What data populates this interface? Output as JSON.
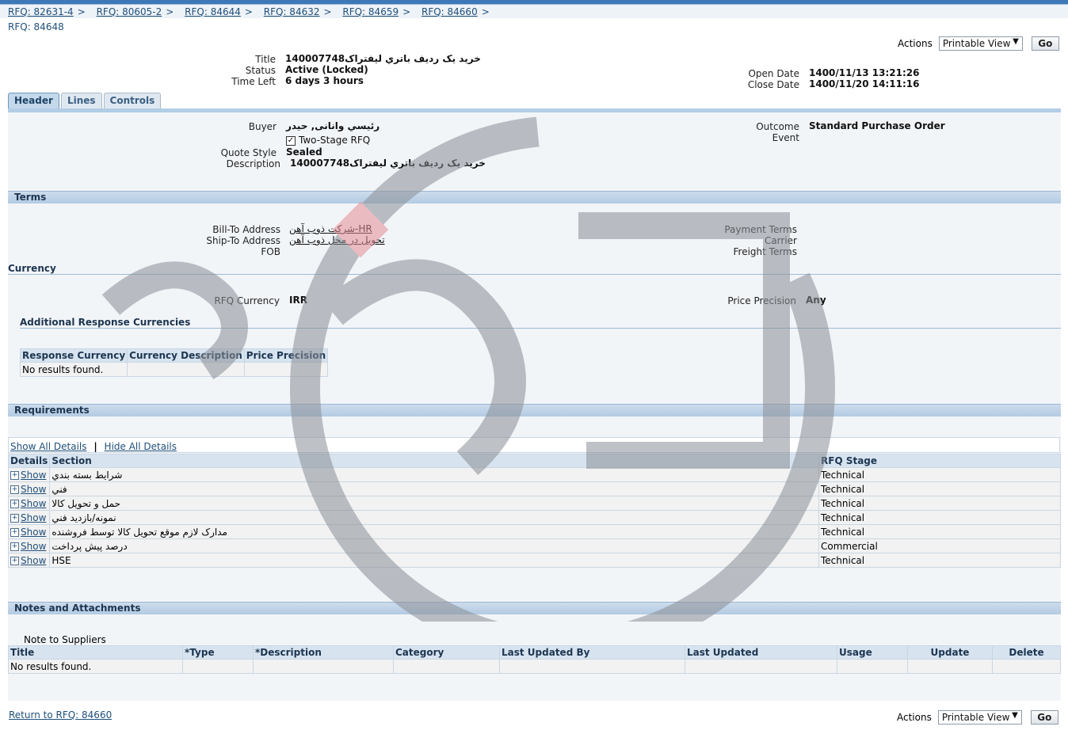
{
  "breadcrumbs": [
    "RFQ: 82631-4",
    "RFQ: 80605-2",
    "RFQ: 84644",
    "RFQ: 84632",
    "RFQ: 84659",
    "RFQ: 84660"
  ],
  "page_title": "RFQ: 84648",
  "actions": {
    "label": "Actions",
    "selected": "Printable View",
    "go": "Go"
  },
  "header_info": {
    "title_label": "Title",
    "title_value": "خرید یک ردیف باتري ليفتراک140007748",
    "status_label": "Status",
    "status_value": "Active (Locked)",
    "time_left_label": "Time Left",
    "time_left_value": "6 days 3 hours",
    "open_date_label": "Open Date",
    "open_date_value": "1400/11/13 13:21:26",
    "close_date_label": "Close Date",
    "close_date_value": "1400/11/20 14:11:16"
  },
  "tabs": [
    "Header",
    "Lines",
    "Controls"
  ],
  "header_section": {
    "buyer_label": "Buyer",
    "buyer_value": "رئیسي وانانی, حیدر",
    "two_stage_label": "Two-Stage RFQ",
    "quote_style_label": "Quote Style",
    "quote_style_value": "Sealed",
    "description_label": "Description",
    "description_value": "خرید یک ردیف باتري ليفتراک140007748",
    "outcome_label": "Outcome",
    "outcome_value": "Standard Purchase Order",
    "event_label": "Event"
  },
  "terms": {
    "section_title": "Terms",
    "bill_to_label": "Bill-To Address",
    "bill_to_value": "شرکت ذوب آهن-HR",
    "ship_to_label": "Ship-To Address",
    "ship_to_value": "تحویل در محل ذوب آهن",
    "fob_label": "FOB",
    "payment_terms_label": "Payment Terms",
    "carrier_label": "Carrier",
    "freight_terms_label": "Freight Terms"
  },
  "currency": {
    "section_title": "Currency",
    "rfq_currency_label": "RFQ Currency",
    "rfq_currency_value": "IRR",
    "price_precision_label": "Price Precision",
    "price_precision_value": "Any",
    "additional_title": "Additional Response Currencies",
    "table_headers": [
      "Response Currency",
      "Currency Description",
      "Price Precision"
    ],
    "no_results": "No results found."
  },
  "requirements": {
    "section_title": "Requirements",
    "show_all": "Show All Details",
    "hide_all": "Hide All Details",
    "headers": {
      "details": "Details",
      "section": "Section",
      "stage": "RFQ Stage"
    },
    "show_label": "Show",
    "rows": [
      {
        "section": "شرایط بسته بندي",
        "stage": "Technical"
      },
      {
        "section": "فني",
        "stage": "Technical"
      },
      {
        "section": "حمل و تحویل کالا",
        "stage": "Technical"
      },
      {
        "section": "نمونه/بازدید فني",
        "stage": "Technical"
      },
      {
        "section": "مدارک لازم موقع تحویل کالا توسط فروشنده",
        "stage": "Technical"
      },
      {
        "section": "درصد پیش پرداخت",
        "stage": "Commercial"
      },
      {
        "section": "HSE",
        "stage": "Technical"
      }
    ]
  },
  "notes": {
    "section_title": "Notes and Attachments",
    "note_to_suppliers": "Note to Suppliers",
    "headers": [
      "Title",
      "*Type",
      "*Description",
      "Category",
      "Last Updated By",
      "Last Updated",
      "Usage",
      "Update",
      "Delete"
    ],
    "no_results": "No results found."
  },
  "return_link": "Return to RFQ: 84660"
}
